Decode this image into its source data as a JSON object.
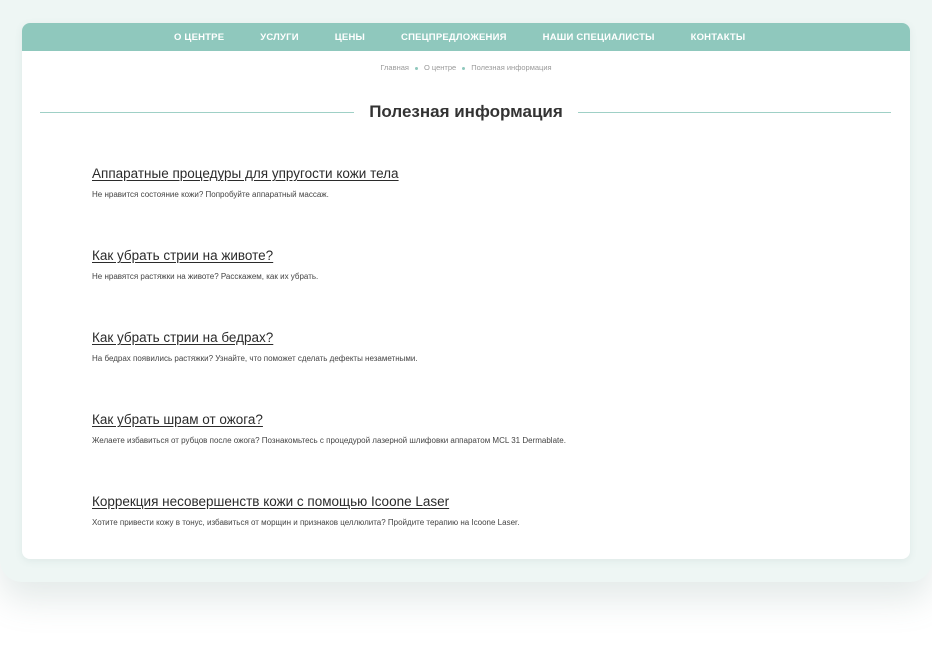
{
  "nav": {
    "items": [
      {
        "label": "О ЦЕНТРЕ"
      },
      {
        "label": "УСЛУГИ"
      },
      {
        "label": "ЦЕНЫ"
      },
      {
        "label": "СПЕЦПРЕДЛОЖЕНИЯ"
      },
      {
        "label": "НАШИ СПЕЦИАЛИСТЫ"
      },
      {
        "label": "КОНТАКТЫ"
      }
    ]
  },
  "breadcrumb": {
    "items": [
      "Главная",
      "О центре",
      "Полезная информация"
    ]
  },
  "page": {
    "title": "Полезная информация"
  },
  "articles": [
    {
      "title": "Аппаратные процедуры для упругости кожи тела",
      "description": "Не нравится состояние кожи? Попробуйте аппаратный массаж."
    },
    {
      "title": "Как убрать стрии на животе?",
      "description": "Не нравятся растяжки на животе? Расскажем, как их убрать."
    },
    {
      "title": "Как убрать стрии на бедрах?",
      "description": "На бедрах появились растяжки? Узнайте, что поможет сделать дефекты незаметными."
    },
    {
      "title": "Как убрать шрам от ожога?",
      "description": "Желаете избавиться от рубцов после ожога? Познакомьтесь с процедурой лазерной шлифовки аппаратом MCL 31 Dermablate."
    },
    {
      "title": "Коррекция несовершенств кожи с помощью Icoone Laser",
      "description": "Хотите привести кожу в тонус, избавиться от морщин и признаков целлюлита? Пройдите терапию на Icoone Laser."
    }
  ],
  "colors": {
    "accent": "#8fc8bd",
    "backdrop": "#eef6f4",
    "text": "#333333"
  }
}
